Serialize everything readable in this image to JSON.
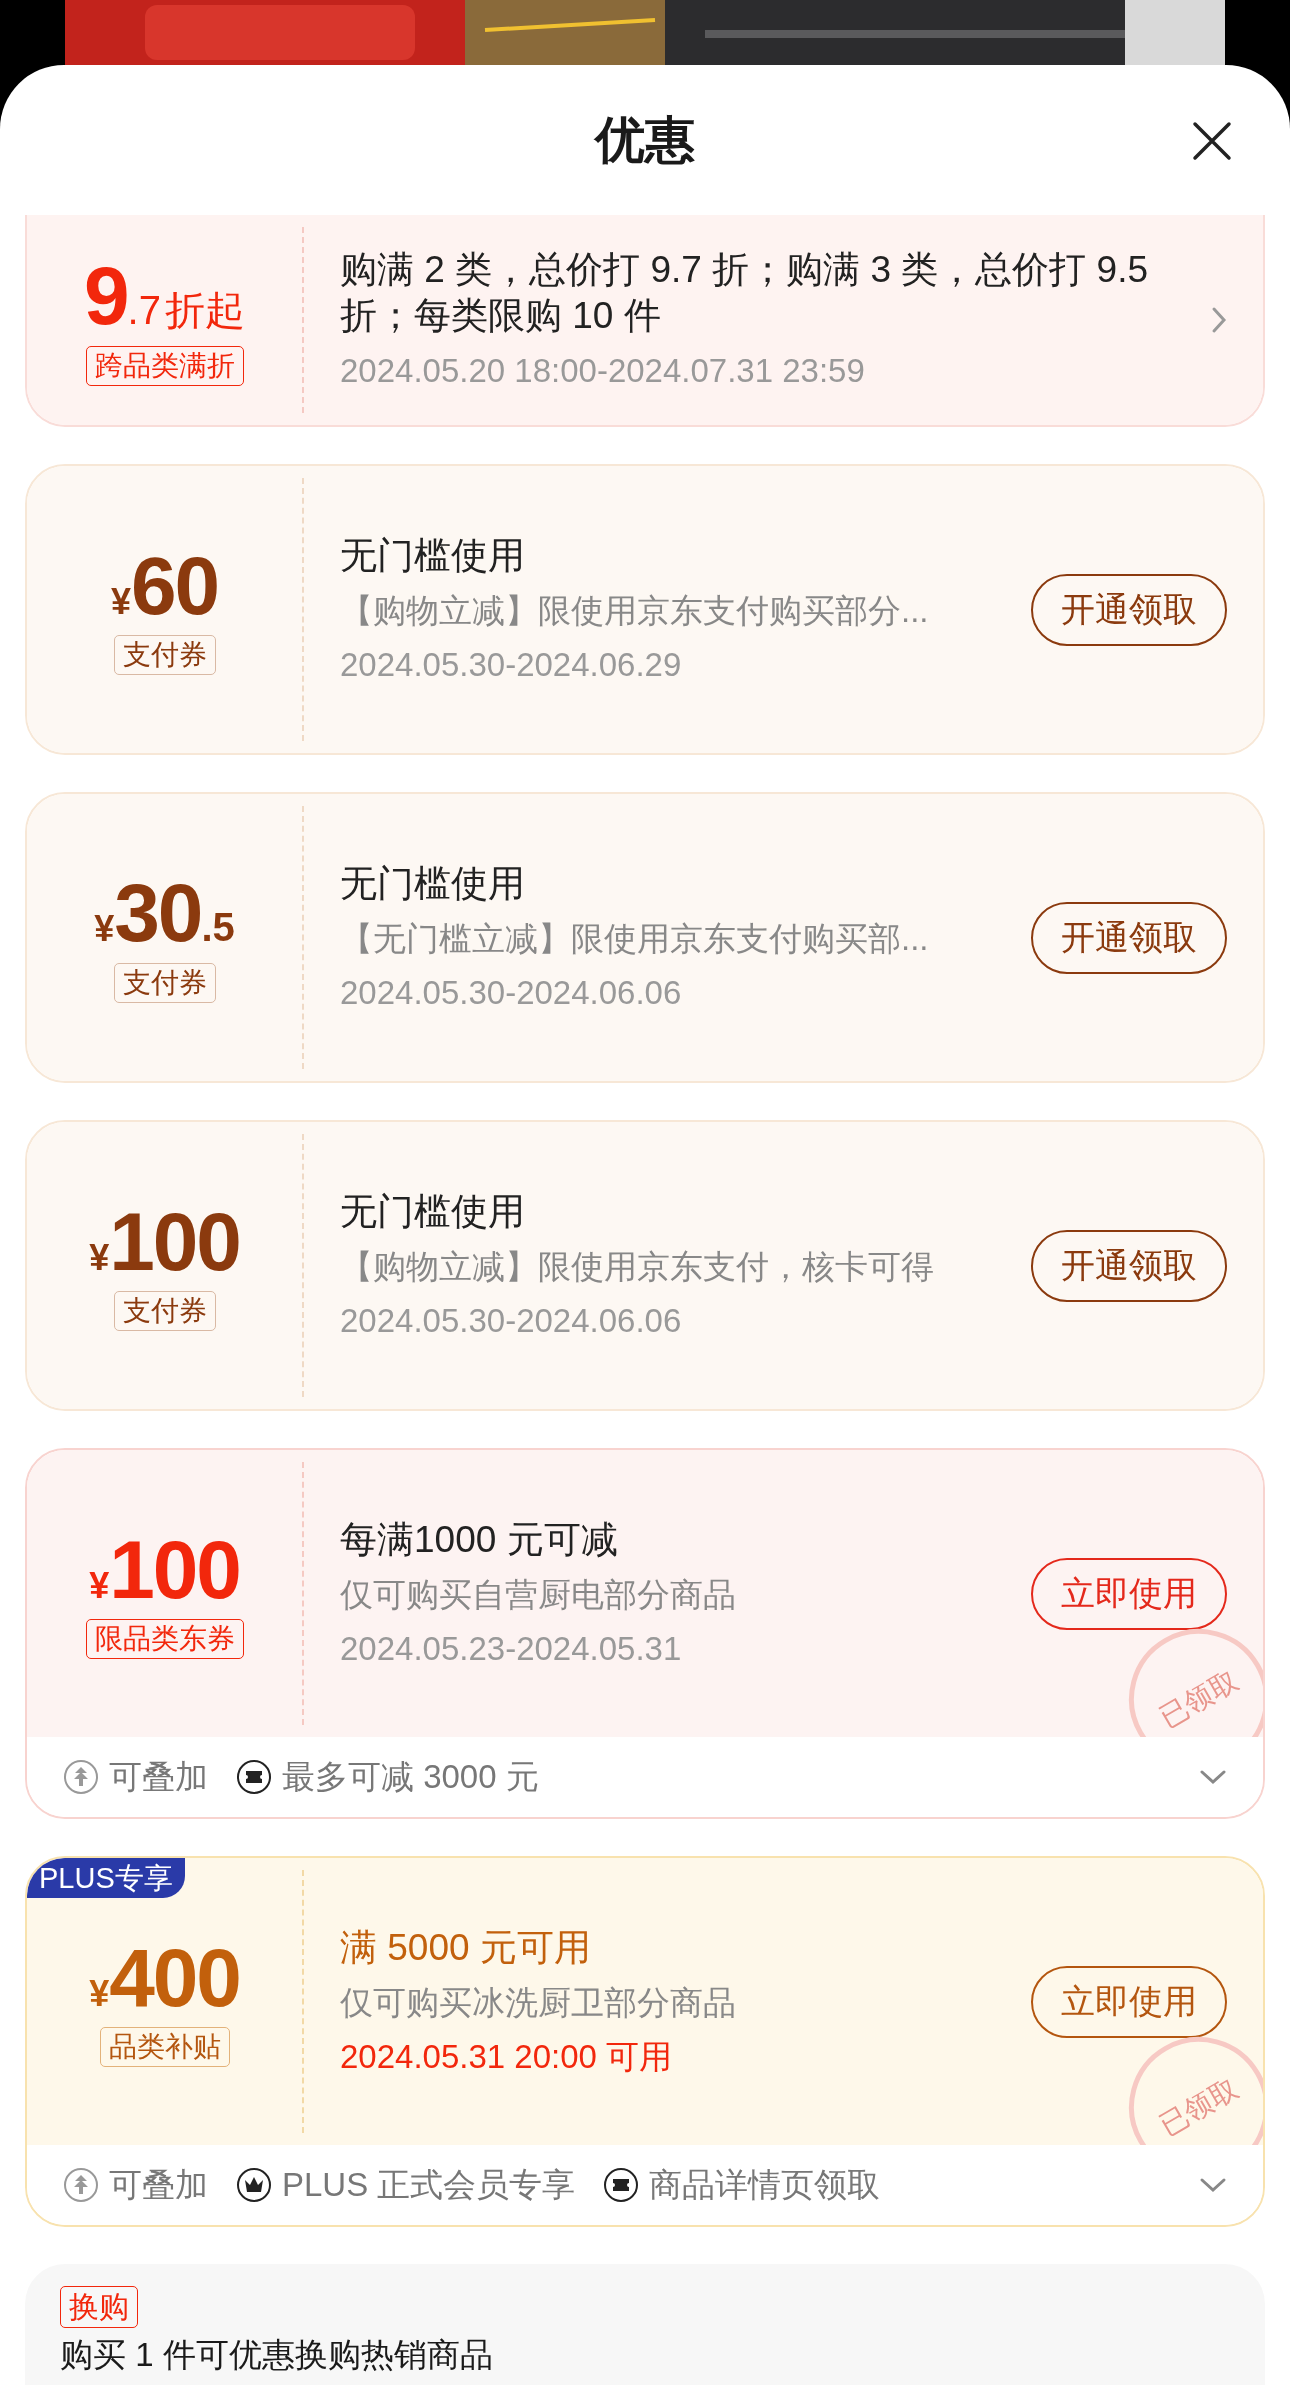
{
  "sheet": {
    "title": "优惠"
  },
  "coupons": [
    {
      "kind": "discount",
      "amount": "9",
      "decimal": ".7",
      "unit": "折起",
      "tag": "跨品类满折",
      "title": "购满 2 类，总价打 9.7 折；购满 3 类，总价打 9.5 折；每类限购 10 件",
      "date": "2024.05.20 18:00-2024.07.31 23:59",
      "date_highlight": false,
      "action": {
        "kind": "chevron"
      }
    },
    {
      "kind": "payment",
      "currency": "¥",
      "amount": "60",
      "tag": "支付券",
      "title": "无门槛使用",
      "subtitle": "【购物立减】限使用京东支付购买部分...",
      "date": "2024.05.30-2024.06.29",
      "date_highlight": false,
      "action": {
        "kind": "button",
        "label": "开通领取"
      }
    },
    {
      "kind": "payment",
      "currency": "¥",
      "amount": "30",
      "decimal": ".5",
      "tag": "支付券",
      "title": "无门槛使用",
      "subtitle": "【无门槛立减】限使用京东支付购买部...",
      "date": "2024.05.30-2024.06.06",
      "date_highlight": false,
      "action": {
        "kind": "button",
        "label": "开通领取"
      }
    },
    {
      "kind": "payment",
      "currency": "¥",
      "amount": "100",
      "tag": "支付券",
      "title": "无门槛使用",
      "subtitle": "【购物立减】限使用京东支付，核卡可得",
      "date": "2024.05.30-2024.06.06",
      "date_highlight": false,
      "action": {
        "kind": "button",
        "label": "开通领取"
      }
    },
    {
      "kind": "category",
      "currency": "¥",
      "amount": "100",
      "tag": "限品类东券",
      "title": "每满1000 元可减",
      "subtitle": "仅可购买自营厨电部分商品",
      "date": "2024.05.23-2024.05.31",
      "date_highlight": false,
      "stamp": "已领取",
      "action": {
        "kind": "button",
        "label": "立即使用"
      },
      "footer": {
        "expanded": false,
        "features": [
          {
            "kind": "stack",
            "text": "可叠加"
          },
          {
            "kind": "ticket",
            "text": "最多可减 3000 元"
          }
        ]
      }
    },
    {
      "kind": "plus",
      "badge": "PLUS专享",
      "currency": "¥",
      "amount": "400",
      "tag": "品类补贴",
      "title": "满 5000 元可用",
      "subtitle": "仅可购买冰洗厨卫部分商品",
      "date": "2024.05.31 20:00 可用",
      "date_highlight": true,
      "stamp": "已领取",
      "action": {
        "kind": "button",
        "label": "立即使用"
      },
      "footer": {
        "expanded": false,
        "features": [
          {
            "kind": "stack",
            "text": "可叠加"
          },
          {
            "kind": "crown",
            "text": "PLUS 正式会员专享"
          },
          {
            "kind": "ticket",
            "text": "商品详情页领取"
          }
        ]
      }
    }
  ],
  "exchange": {
    "tag": "换购",
    "title": "购买 1 件可优惠换购热销商品"
  }
}
